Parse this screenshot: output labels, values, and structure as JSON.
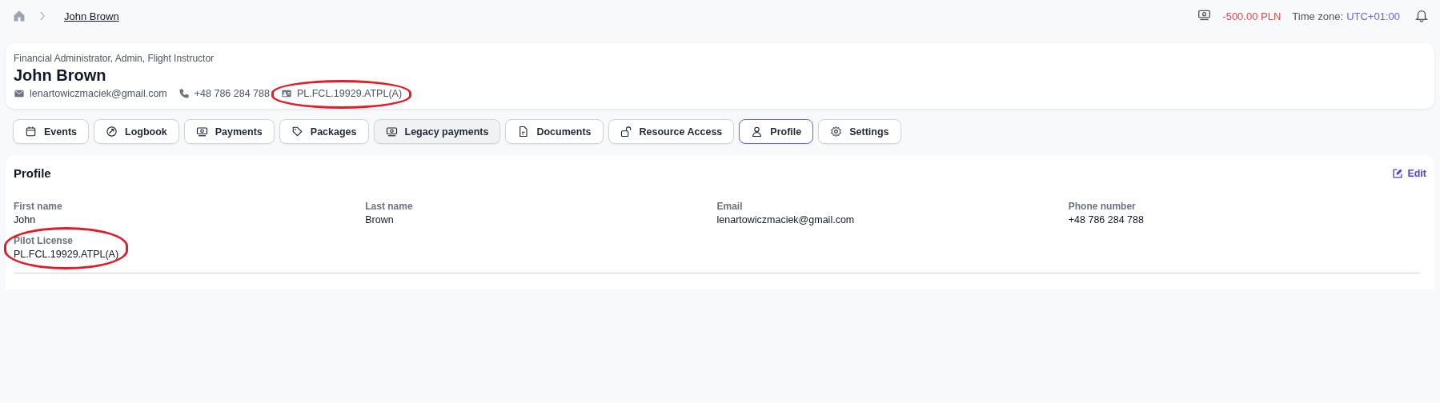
{
  "breadcrumb": {
    "current": "John Brown"
  },
  "topbar": {
    "balance": "-500.00 PLN",
    "timezone_label": "Time zone:",
    "timezone": "UTC+01:00"
  },
  "header": {
    "roles": "Financial Administrator, Admin, Flight Instructor",
    "name": "John Brown",
    "contacts": [
      {
        "kind": "email",
        "text": "lenartowiczmaciek@gmail.com",
        "circled": false
      },
      {
        "kind": "phone",
        "text": "+48 786 284 788",
        "circled": false
      },
      {
        "kind": "license",
        "text": "PL.FCL.19929.ATPL(A)",
        "circled": true
      }
    ]
  },
  "tabs": [
    {
      "kind": "calendar",
      "label": "Events",
      "selected": false,
      "hovered": false
    },
    {
      "kind": "logbook",
      "label": "Logbook",
      "selected": false,
      "hovered": false
    },
    {
      "kind": "money",
      "label": "Payments",
      "selected": false,
      "hovered": false
    },
    {
      "kind": "tag",
      "label": "Packages",
      "selected": false,
      "hovered": false
    },
    {
      "kind": "money",
      "label": "Legacy payments",
      "selected": false,
      "hovered": true
    },
    {
      "kind": "document",
      "label": "Documents",
      "selected": false,
      "hovered": false
    },
    {
      "kind": "lock",
      "label": "Resource Access",
      "selected": false,
      "hovered": false
    },
    {
      "kind": "user",
      "label": "Profile",
      "selected": true,
      "hovered": false
    },
    {
      "kind": "gear",
      "label": "Settings",
      "selected": false,
      "hovered": false
    }
  ],
  "profile": {
    "title": "Profile",
    "edit": "Edit",
    "fields": [
      {
        "label": "First name",
        "value": "John",
        "circled": false
      },
      {
        "label": "Last name",
        "value": "Brown",
        "circled": false
      },
      {
        "label": "Email",
        "value": "lenartowiczmaciek@gmail.com",
        "circled": false
      },
      {
        "label": "Phone number",
        "value": "+48 786 284 788",
        "circled": false
      },
      {
        "label": "Pilot License",
        "value": "PL.FCL.19929.ATPL(A)",
        "circled": true
      }
    ]
  }
}
